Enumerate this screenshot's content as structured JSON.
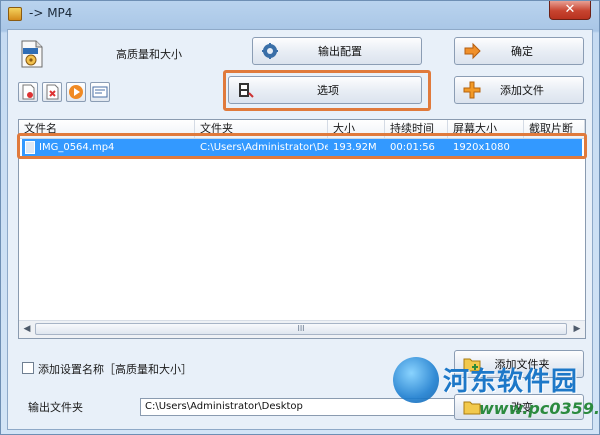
{
  "window": {
    "title": "-> MP4",
    "close_glyph": "✕"
  },
  "profile": {
    "icon": "mp4-file-icon",
    "label": "高质量和大小"
  },
  "buttons": {
    "output_config": "输出配置",
    "ok": "确定",
    "options": "选项",
    "add_file": "添加文件",
    "add_folder": "添加文件夹",
    "change": "改变"
  },
  "toolbar_icons": [
    "remove-file-icon",
    "clear-list-icon",
    "play-icon",
    "media-info-icon"
  ],
  "list": {
    "columns": [
      "文件名",
      "文件夹",
      "大小",
      "持续时间",
      "屏幕大小",
      "截取片断"
    ],
    "rows": [
      {
        "name": "IMG_0564.mp4",
        "folder": "C:\\Users\\Administrator\\Des...",
        "size": "193.92M",
        "duration": "00:01:56",
        "screen": "1920x1080",
        "clip": ""
      }
    ],
    "scroll_grip": "III"
  },
  "settings": {
    "add_setting_name_label": "添加设置名称［高质量和大小］",
    "checked": false
  },
  "output": {
    "label": "输出文件夹",
    "path": "C:\\Users\\Administrator\\Desktop"
  },
  "watermark": {
    "name": "河东软件园",
    "url": "www.pc0359.cn"
  },
  "colors": {
    "selection": "#3399ff",
    "highlight_box": "#e07a3c",
    "close_button": "#c7432f"
  }
}
